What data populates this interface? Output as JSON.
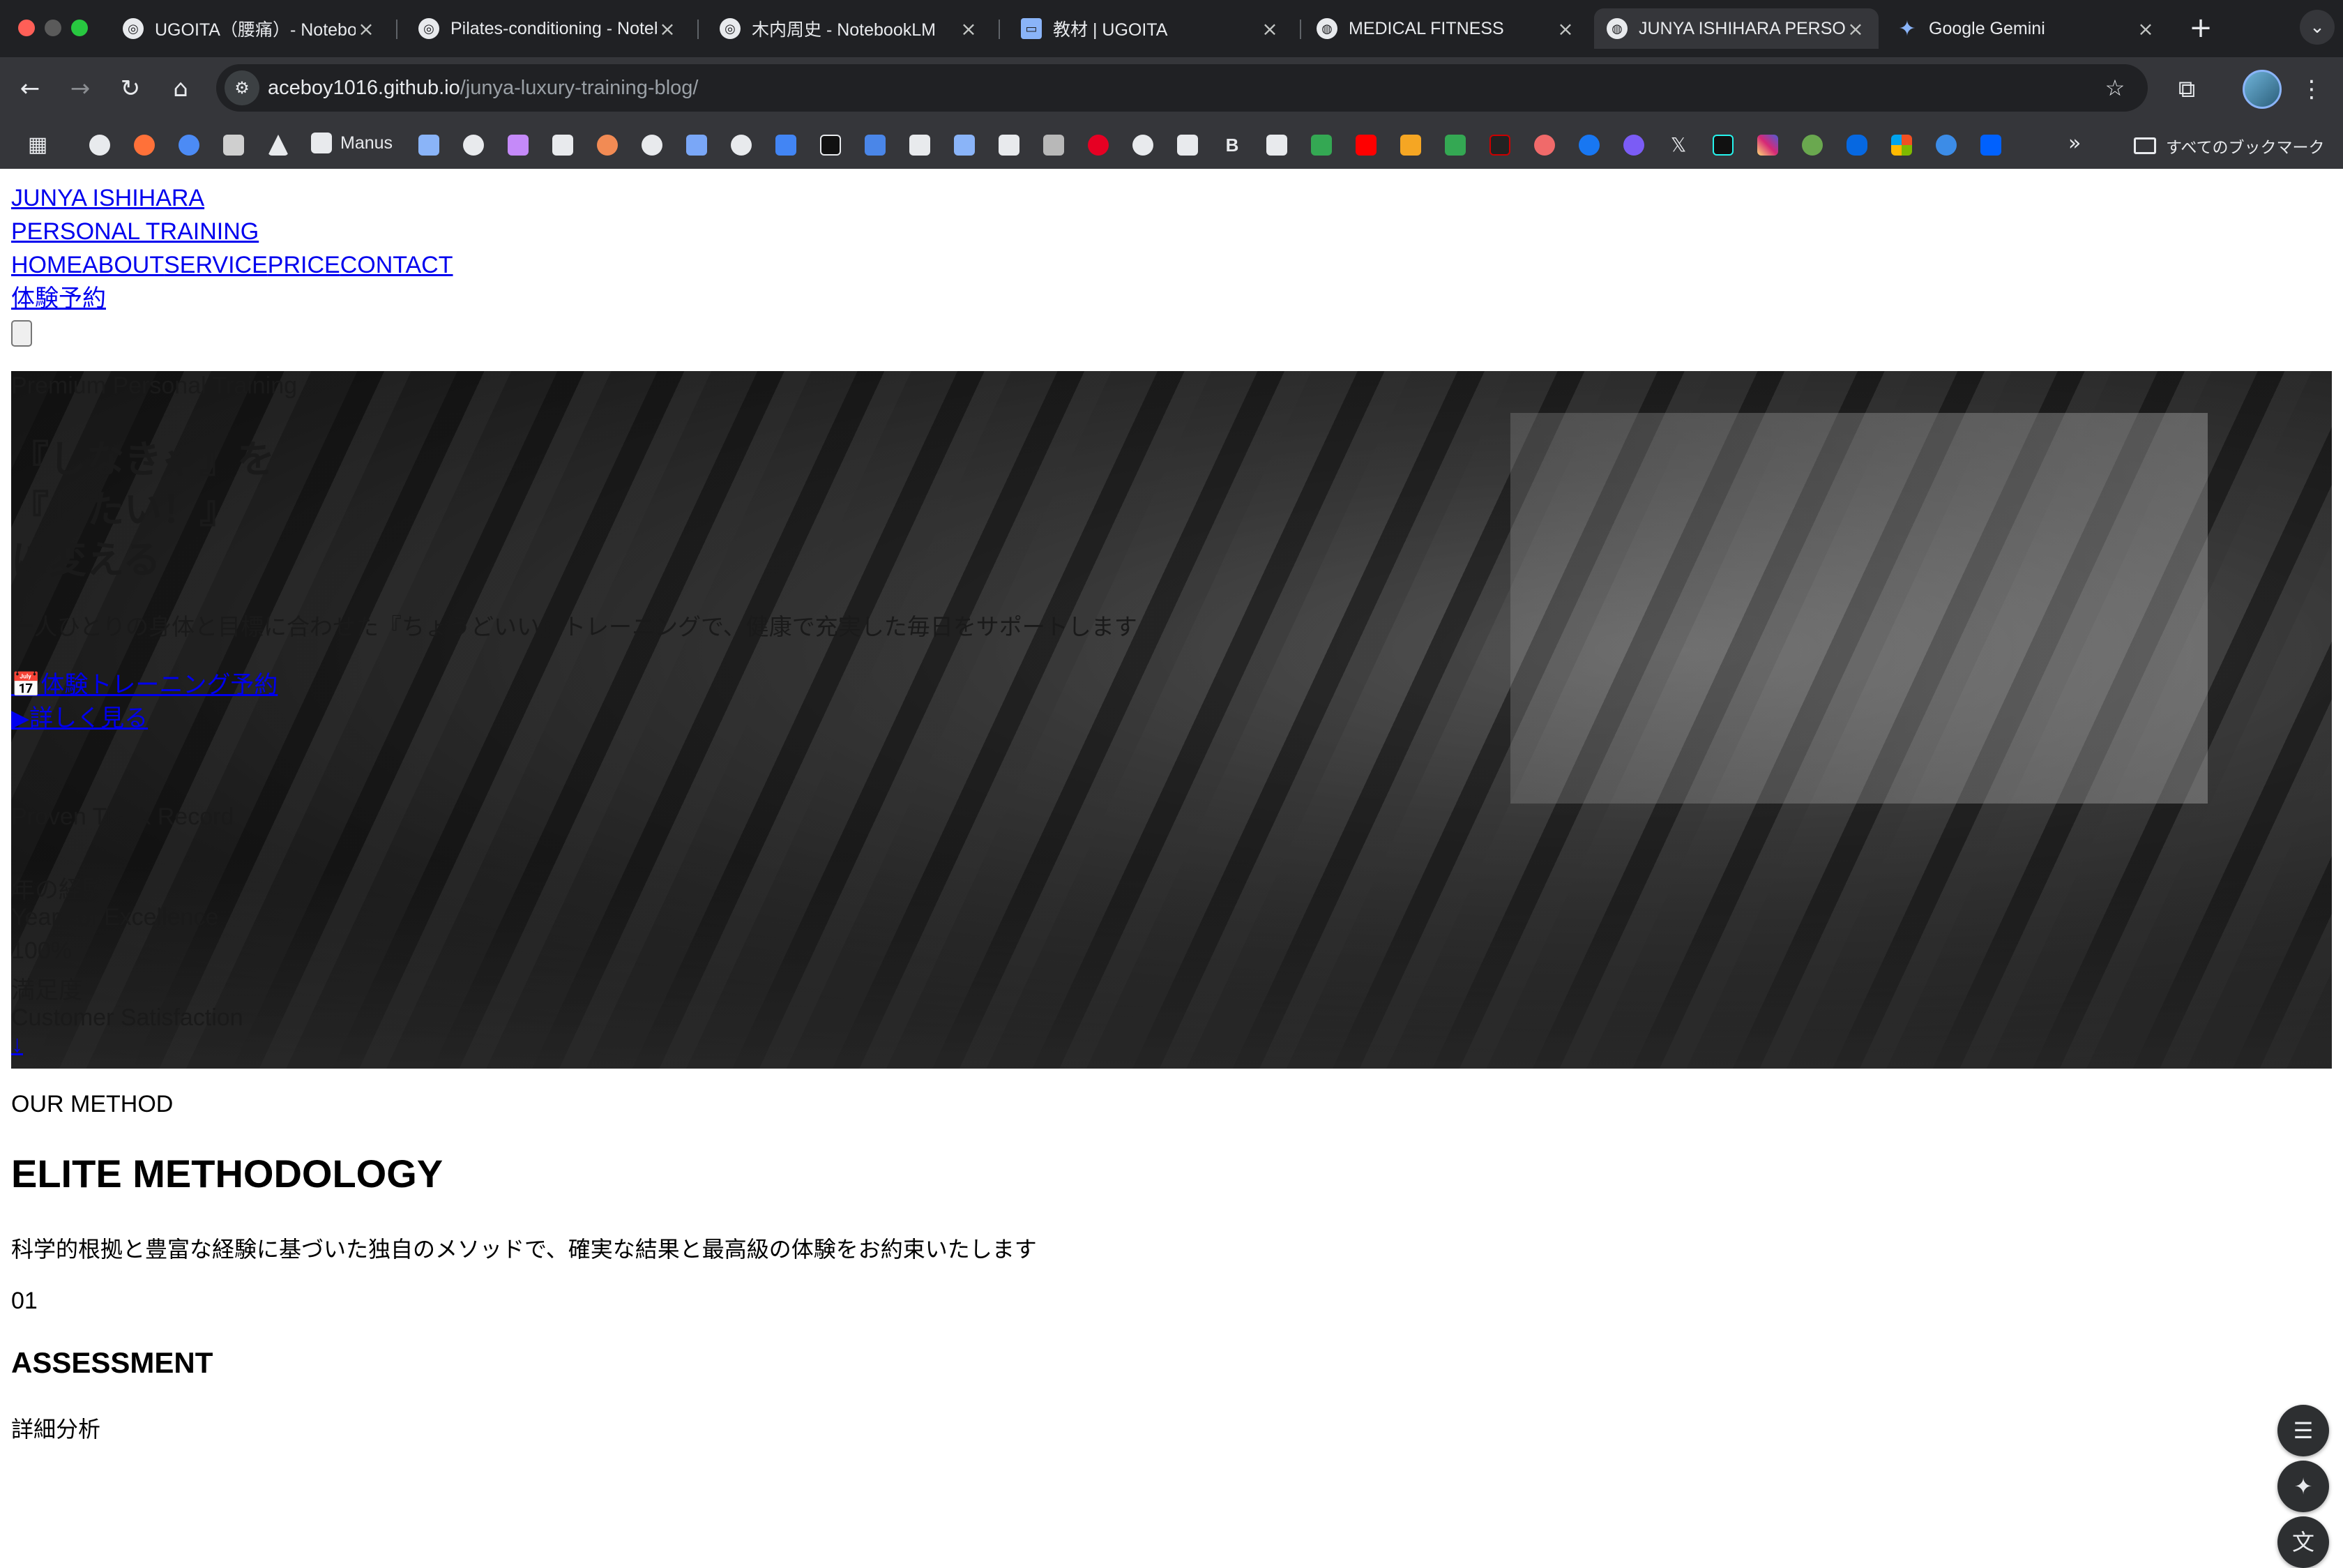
{
  "browser": {
    "tabs": [
      {
        "label": "UGOITA（腰痛）- NotebookLM",
        "favicon": "notebooklm-icon"
      },
      {
        "label": "Pilates-conditioning - NotebookLM",
        "favicon": "notebooklm-icon"
      },
      {
        "label": "木内周史 - NotebookLM",
        "favicon": "notebooklm-icon"
      },
      {
        "label": "教材 | UGOITA",
        "favicon": "laptop-icon"
      },
      {
        "label": "MEDICAL FITNESS",
        "favicon": "globe-icon"
      },
      {
        "label": "JUNYA ISHIHARA PERSONAL TRAINING",
        "favicon": "globe-icon",
        "active": true
      },
      {
        "label": "Google Gemini",
        "favicon": "gemini-sparkle-icon"
      }
    ],
    "url_host": "aceboy1016.github.io",
    "url_path": "/junya-luxury-training-blog/",
    "bookmarks": {
      "manus_label": "Manus",
      "all_bookmarks_label": "すべてのブックマーク",
      "more_glyph": "»"
    }
  },
  "site": {
    "logo_line1": "JUNYA ISHIHARA",
    "logo_line2": "PERSONAL TRAINING",
    "nav": [
      "HOME",
      "ABOUT",
      "SERVICE",
      "PRICE",
      "CONTACT"
    ],
    "trial_link": "体験予約"
  },
  "hero": {
    "eyebrow": "Premium Personal Training",
    "title_lines": [
      "『しなきゃ』を",
      "『したい！』",
      "に変える"
    ],
    "description": "一人ひとりの身体と目標に合わせた『ちょうどいい』トレーニングで、健康で充実した毎日をサポートします",
    "cta_primary_icon": "📅",
    "cta_primary": "体験トレーニング予約",
    "cta_secondary": "▶詳しく見る",
    "track_record_label": "Proven Track Record",
    "stats": [
      "年の経験",
      "Years of Excellence",
      "100%",
      "満足度",
      "Customer Satisfaction"
    ],
    "scroll_cue": "↓"
  },
  "method": {
    "eyebrow": "OUR METHOD",
    "title": "ELITE METHODOLOGY",
    "description": "科学的根拠と豊富な経験に基づいた独自のメソッドで、確実な結果と最高級の体験をお約束いたします",
    "step_number": "01",
    "step_title": "ASSESSMENT",
    "step_subtitle": "詳細分析"
  },
  "colors": {
    "tabbar_bg": "#202124",
    "toolbar_bg": "#35363a",
    "link": "#0000ee",
    "hero_overlay": "#1a1a1a"
  }
}
